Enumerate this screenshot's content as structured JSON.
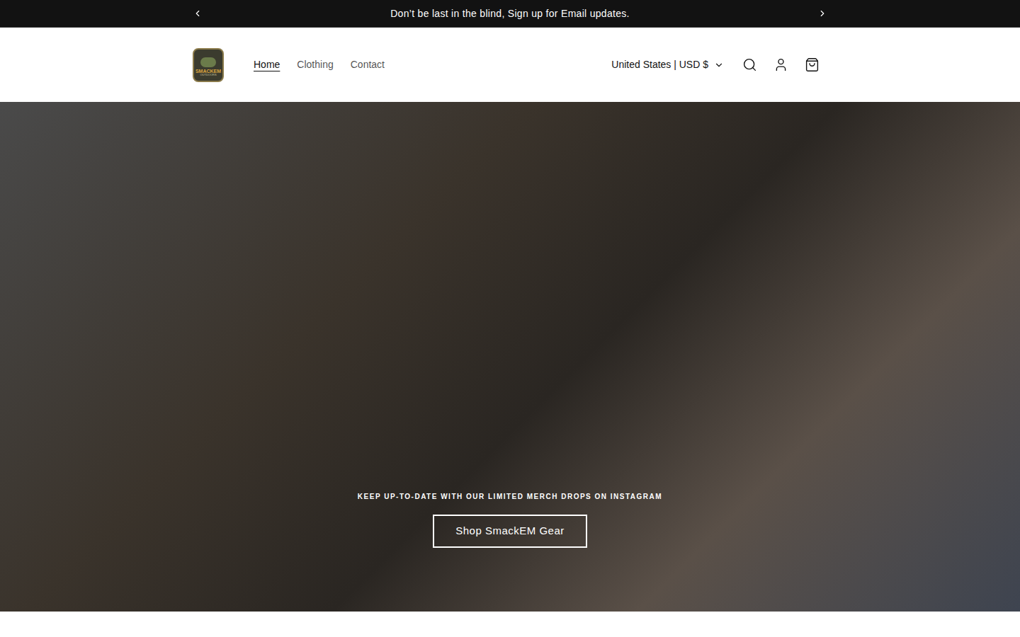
{
  "announcement": {
    "text": "Don’t be last in the blind, Sign up for Email updates."
  },
  "logo": {
    "name": "SMACKEM",
    "sub": "OUTDOORS"
  },
  "nav": [
    {
      "label": "Home",
      "selected": true
    },
    {
      "label": "Clothing",
      "selected": false
    },
    {
      "label": "Contact",
      "selected": false
    }
  ],
  "locale": {
    "label": "United States | USD $"
  },
  "hero": {
    "caption": "KEEP UP-TO-DATE WITH OUR LIMITED MERCH DROPS ON INSTAGRAM",
    "button": "Shop SmackEM Gear"
  }
}
